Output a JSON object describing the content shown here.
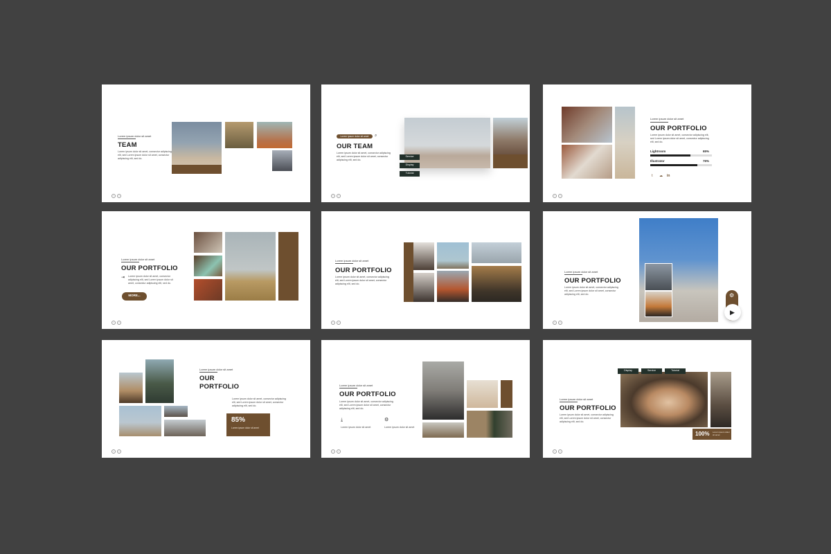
{
  "lorem_kicker": "Lorem ipsum dolor sit amet",
  "lorem_body_3": "Lorem ipsum dolor sit amet, consectur adipiscing elit, sed Lorem ipsum dolor sit amet, consectur adipiscing elit, sed do.",
  "lorem_short": "Lorem ipsum dolor sit amet",
  "slides": [
    {
      "title": "TEAM"
    },
    {
      "title": "OUR TEAM",
      "tags": [
        "Service",
        "Display",
        "Tutorial"
      ]
    },
    {
      "title": "OUR PORTFOLIO",
      "skills": [
        {
          "label": "Lightroom",
          "value": "65%"
        },
        {
          "label": "Illustrator",
          "value": "76%"
        }
      ]
    },
    {
      "title": "OUR PORTFOLIO",
      "more_button": "MORE..."
    },
    {
      "title": "OUR PORTFOLIO"
    },
    {
      "title": "OUR PORTFOLIO"
    },
    {
      "title_line1": "OUR",
      "title_line2": "PORTFOLIO",
      "stat": "85%"
    },
    {
      "title": "OUR PORTFOLIO"
    },
    {
      "title": "OUR PORTFOLIO",
      "tags": [
        "Display",
        "Service",
        "Tutorial"
      ],
      "stat": "100%"
    }
  ],
  "nav": {
    "prev": "‹",
    "next": "›"
  },
  "colors": {
    "background": "#414141",
    "brown": "#6e4f2f",
    "dark_green": "#22302a"
  },
  "icons": [
    "search-icon",
    "login-icon",
    "twitter-icon",
    "cloud-icon",
    "linkedin-icon",
    "gear-icon",
    "play-icon",
    "download-icon",
    "cogs-icon"
  ]
}
